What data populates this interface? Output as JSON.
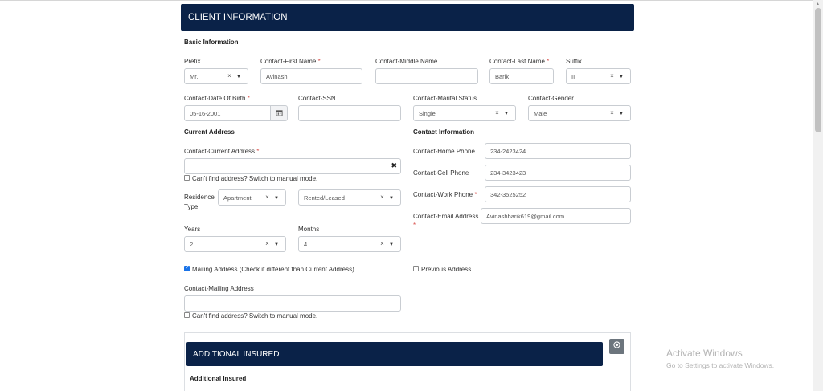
{
  "header": {
    "title": "CLIENT INFORMATION"
  },
  "basic": {
    "section_title": "Basic Information",
    "prefix": {
      "label": "Prefix",
      "value": "Mr."
    },
    "first_name": {
      "label": "Contact-First Name",
      "value": "Avinash"
    },
    "middle_name": {
      "label": "Contact-Middle Name",
      "value": ""
    },
    "last_name": {
      "label": "Contact-Last Name",
      "value": "Barik"
    },
    "suffix": {
      "label": "Suffix",
      "value": "II"
    },
    "dob": {
      "label": "Contact-Date Of Birth",
      "value": "05-16-2001"
    },
    "ssn": {
      "label": "Contact-SSN",
      "value": ""
    },
    "marital": {
      "label": "Contact-Marital Status",
      "value": "Single"
    },
    "gender": {
      "label": "Contact-Gender",
      "value": "Male"
    }
  },
  "current_address": {
    "section_title": "Current Address",
    "address_label": "Contact-Current Address",
    "address_value": "",
    "manual_mode": "Can't find address? Switch to manual mode.",
    "residence_label_1": "Residence",
    "residence_label_2": "Type",
    "residence_type": "Apartment",
    "ownership": "Rented/Leased",
    "years_label": "Years",
    "years_value": "2",
    "months_label": "Months",
    "months_value": "4",
    "mailing_check_label": "Mailing Address (Check if different than Current Address)",
    "mailing_label": "Contact-Mailing Address",
    "mailing_value": "",
    "mailing_manual_mode": "Can't find address? Switch to manual mode."
  },
  "contact_info": {
    "section_title": "Contact Information",
    "home_label": "Contact-Home Phone",
    "home_value": "234-2423424",
    "cell_label": "Contact-Cell Phone",
    "cell_value": "234-3423423",
    "work_label": "Contact-Work Phone",
    "work_value": "342-3525252",
    "email_label": "Contact-Email Address",
    "email_value": "Avinashbarik619@gmail.com",
    "previous_address_label": "Previous Address"
  },
  "additional": {
    "header_title": "ADDITIONAL INSURED",
    "sub_title": "Additional Insured"
  },
  "common": {
    "required_mark": "*",
    "clear_mark": "×",
    "dropdown_arrow": "▼",
    "remove_mark": "✖"
  },
  "watermark": {
    "title": "Activate Windows",
    "subtitle": "Go to Settings to activate Windows."
  },
  "colors": {
    "header_bg": "#0a2248",
    "required": "#d9534f",
    "checkbox": "#1a73e8"
  }
}
